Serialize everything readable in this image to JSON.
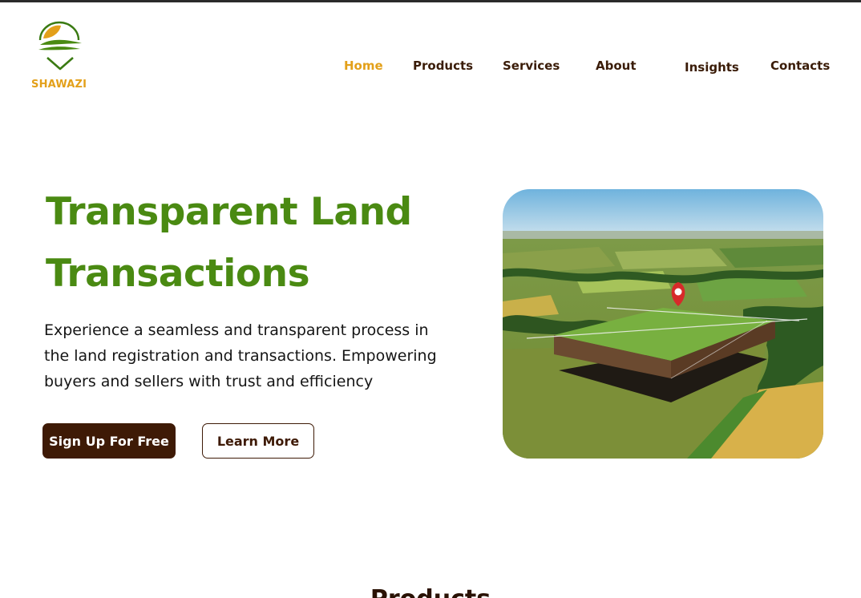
{
  "brand": {
    "name": "SHAWAZI",
    "logo_icon": "sun-hills-check-icon",
    "colors": {
      "gold": "#e3a01a",
      "green": "#4a8a12",
      "brown": "#3e1a06"
    }
  },
  "nav": {
    "items": [
      {
        "label": "Home",
        "active": true
      },
      {
        "label": "Products",
        "active": false
      },
      {
        "label": "Services",
        "active": false
      },
      {
        "label": "About",
        "active": false
      },
      {
        "label": "Insights",
        "active": false
      },
      {
        "label": "Contacts",
        "active": false
      }
    ]
  },
  "hero": {
    "title_line1": "Transparent Land",
    "title_line2": "Transactions",
    "description": "Experience a seamless and transparent process in the land registration and transactions. Empowering buyers and sellers with trust and efficiency",
    "primary_button": "Sign Up For Free",
    "secondary_button": "Learn More",
    "image_icon": "land-plot-location-pin-illustration"
  },
  "next_section": {
    "title": "Products"
  }
}
